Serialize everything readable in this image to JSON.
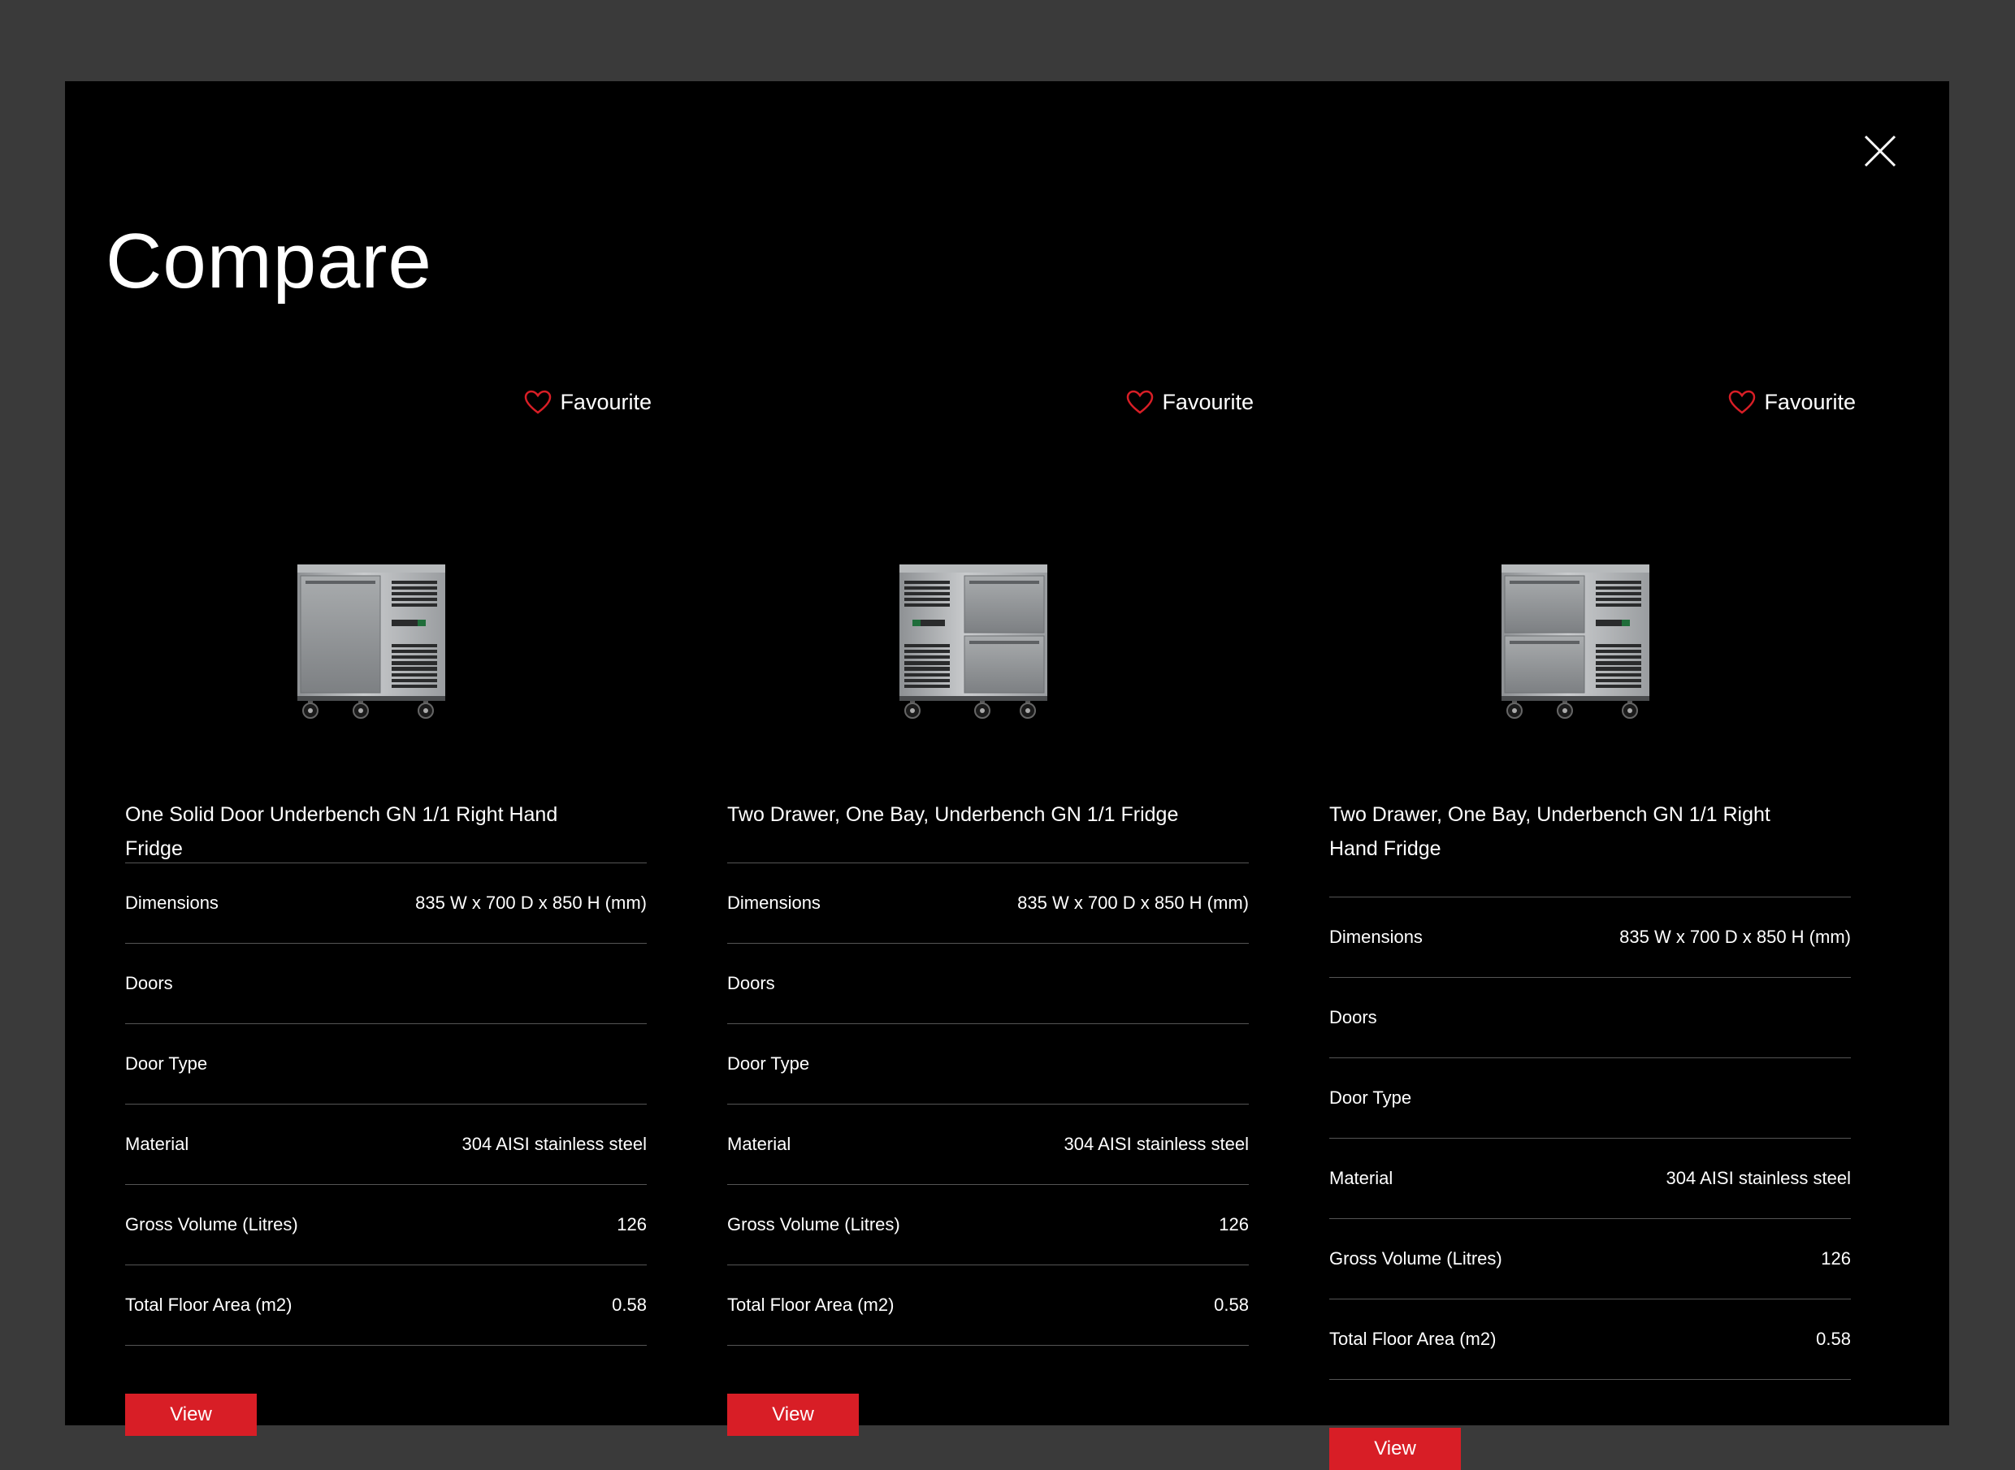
{
  "modal": {
    "title": "Compare",
    "close_icon": "close-icon"
  },
  "favourite_label": "Favourite",
  "view_label": "View",
  "colors": {
    "accent": "#d81e26",
    "background": "#000000",
    "page_background": "#3a3a3a",
    "divider": "#555555"
  },
  "products": [
    {
      "name": "One Solid Door Underbench GN 1/1 Right Hand Fridge",
      "image": "fridge-solid-door-icon",
      "specs": [
        {
          "label": "Dimensions",
          "value": "835 W x 700 D x 850 H (mm)"
        },
        {
          "label": "Doors",
          "value": ""
        },
        {
          "label": "Door Type",
          "value": ""
        },
        {
          "label": "Material",
          "value": "304 AISI stainless steel"
        },
        {
          "label": "Gross Volume (Litres)",
          "value": "126"
        },
        {
          "label": "Total Floor Area (m2)",
          "value": "0.58"
        }
      ]
    },
    {
      "name": "Two Drawer, One Bay, Underbench GN 1/1 Fridge",
      "image": "fridge-two-drawer-icon",
      "specs": [
        {
          "label": "Dimensions",
          "value": "835 W x 700 D x 850 H (mm)"
        },
        {
          "label": "Doors",
          "value": ""
        },
        {
          "label": "Door Type",
          "value": ""
        },
        {
          "label": "Material",
          "value": "304 AISI stainless steel"
        },
        {
          "label": "Gross Volume (Litres)",
          "value": "126"
        },
        {
          "label": "Total Floor Area (m2)",
          "value": "0.58"
        }
      ]
    },
    {
      "name": "Two Drawer, One Bay, Underbench GN 1/1 Right Hand Fridge",
      "image": "fridge-two-drawer-right-icon",
      "specs": [
        {
          "label": "Dimensions",
          "value": "835 W x 700 D x 850 H (mm)"
        },
        {
          "label": "Doors",
          "value": ""
        },
        {
          "label": "Door Type",
          "value": ""
        },
        {
          "label": "Material",
          "value": "304 AISI stainless steel"
        },
        {
          "label": "Gross Volume (Litres)",
          "value": "126"
        },
        {
          "label": "Total Floor Area (m2)",
          "value": "0.58"
        }
      ]
    }
  ]
}
